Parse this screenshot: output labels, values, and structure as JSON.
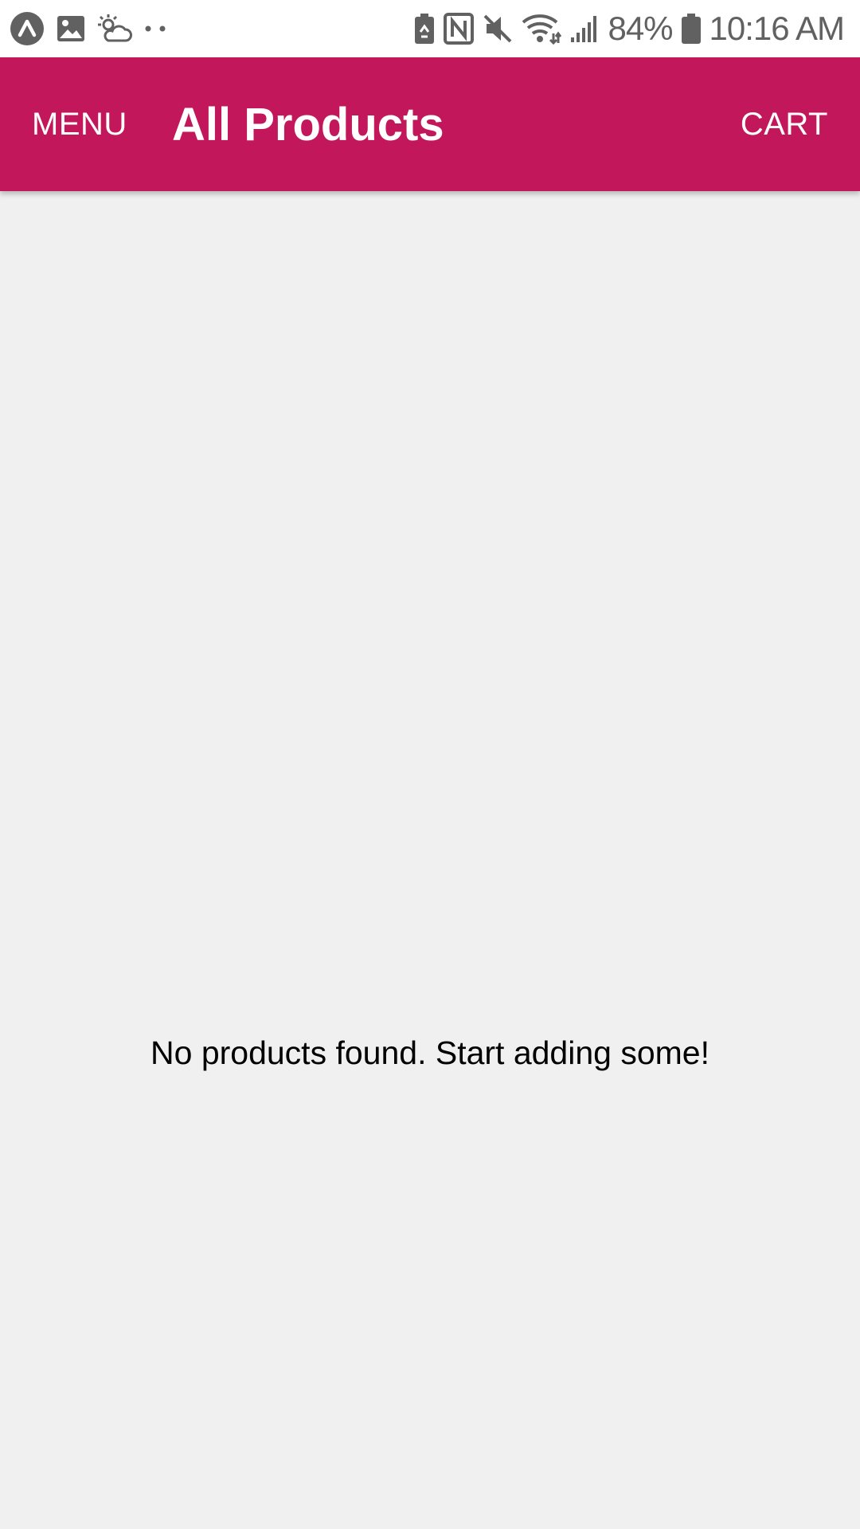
{
  "status_bar": {
    "icons_left": [
      "app-launcher-icon",
      "image-icon",
      "weather-icon",
      "more-dots-icon"
    ],
    "icons_right": [
      "battery-saver-icon",
      "nfc-icon",
      "mute-icon",
      "wifi-icon",
      "signal-icon",
      "battery-icon"
    ],
    "battery_percent": "84%",
    "time": "10:16 AM"
  },
  "app_bar": {
    "menu_label": "MENU",
    "title": "All Products",
    "cart_label": "CART",
    "color": "#c2185b"
  },
  "content": {
    "empty_message": "No products found. Start adding some!",
    "background": "#f0f0f0"
  }
}
